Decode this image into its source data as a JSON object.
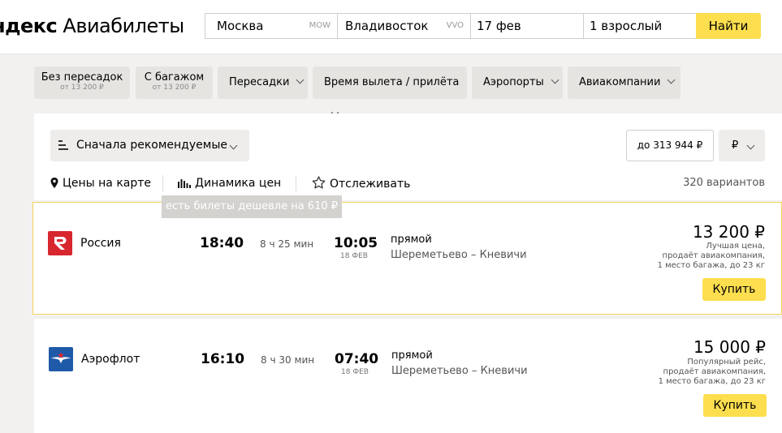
{
  "header": {
    "logo_bold": "ндекс",
    "logo_rest": " Авиабилеты",
    "from_city": "Москва",
    "from_code": "MOW",
    "to_city": "Владивосток",
    "to_code": "VVO",
    "date": "17 фев",
    "passengers": "1 взрослый",
    "find_label": "Найти"
  },
  "filters": {
    "nonstop_label": "Без пересадок",
    "nonstop_price": "от 13 200 ₽",
    "baggage_label": "С багажом",
    "baggage_price": "от 13 200 ₽",
    "transfers": "Пересадки",
    "time": "Время вылета / прилёта",
    "airports": "Аэропорты",
    "airlines": "Авиакомпании"
  },
  "toolbar": {
    "sort_label": "Сначала рекомендуемые",
    "max_price": "до 313 944 ₽",
    "currency": "₽",
    "map_label": "Цены на карте",
    "dynamics_label": "Динамика цен",
    "track_label": "Отслеживать",
    "variants": "320 вариантов",
    "tooltip": "есть билеты дешевле на 610 ₽"
  },
  "flights": [
    {
      "airline": "Россия",
      "logo_icon": "rossiya-logo-icon",
      "logo_color": "#d8262f",
      "dep_time": "18:40",
      "duration": "8 ч 25 мин",
      "arr_time": "10:05",
      "arr_date": "18 ФЕВ",
      "stops": "прямой",
      "airports": "Шереметьево – Кневичи",
      "price": "13 200 ₽",
      "note_1": "Лучшая цена,",
      "note_2": "продаёт авиакомпания,",
      "note_3": "1 место багажа, до 23 кг",
      "buy_label": "Купить"
    },
    {
      "airline": "Аэрофлот",
      "logo_icon": "aeroflot-logo-icon",
      "logo_color": "#1e5aa8",
      "dep_time": "16:10",
      "duration": "8 ч 30 мин",
      "arr_time": "07:40",
      "arr_date": "18 ФЕВ",
      "stops": "прямой",
      "airports": "Шереметьево – Кневичи",
      "price": "15 000 ₽",
      "note_1": "Популярный рейс,",
      "note_2": "продаёт авиакомпания,",
      "note_3": "1 место багажа, до 23 кг",
      "buy_label": "Купить"
    }
  ],
  "colors": {
    "accent": "#fdde4f",
    "selected_border": "#f5d35a",
    "background": "#f2f1ef"
  }
}
